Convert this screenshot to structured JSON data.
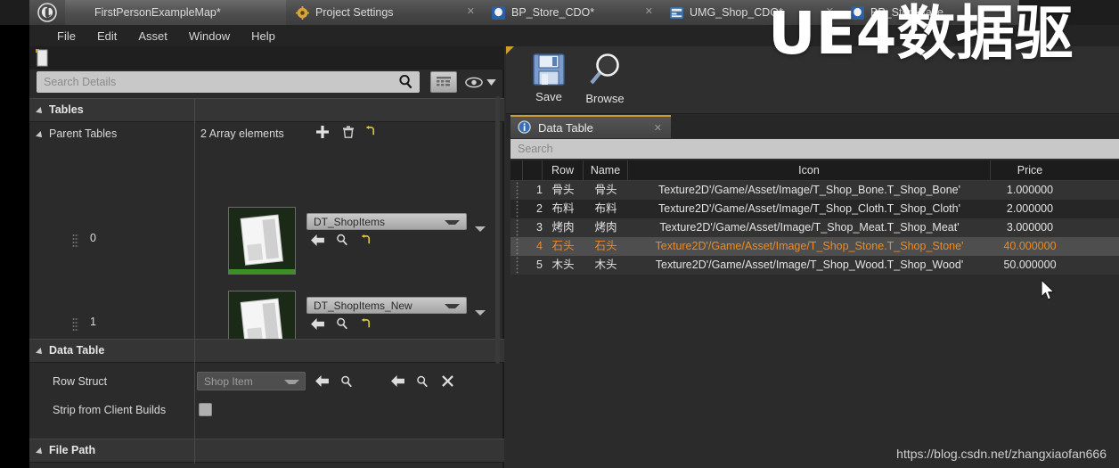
{
  "app": {
    "logo_icon": "unreal-engine-logo",
    "overlay_text": "UE4数据驱",
    "watermark": "https://blog.csdn.net/zhangxiaofan666"
  },
  "tabs": [
    {
      "label": "FirstPersonExampleMap*",
      "icon": "unreal-logo-icon",
      "active": true,
      "closable": false
    },
    {
      "label": "Project Settings",
      "icon": "gear-icon",
      "active": false,
      "closable": true
    },
    {
      "label": "BP_Store_CDO*",
      "icon": "blueprint-icon",
      "active": false,
      "closable": true
    },
    {
      "label": "UMG_Shop_CDO*",
      "icon": "widget-icon",
      "active": false,
      "closable": true
    },
    {
      "label": "BP_StoreBase",
      "icon": "blueprint-icon",
      "active": false,
      "closable": true
    }
  ],
  "menubar": {
    "items": [
      "File",
      "Edit",
      "Asset",
      "Window",
      "Help"
    ]
  },
  "details_panel": {
    "search": {
      "placeholder": "Search Details",
      "value": ""
    },
    "grid_button_icon": "grid-view-icon",
    "eye_button_icon": "eye-icon",
    "caret_icon": "chevron-down-icon",
    "categories": [
      {
        "label": "Tables"
      },
      {
        "label": "Data Table"
      },
      {
        "label": "File Path"
      }
    ],
    "parent_tables": {
      "label": "Parent Tables",
      "array_count": "2 Array elements",
      "add_icon": "plus-icon",
      "delete_icon": "trash-icon",
      "reset_icon": "revert-arrow-icon",
      "elements": [
        {
          "index": "0",
          "asset": "DT_ShopItems",
          "thumb_icon": "datatable-asset-thumbnail"
        },
        {
          "index": "1",
          "asset": "DT_ShopItems_New",
          "thumb_icon": "datatable-asset-thumbnail"
        }
      ],
      "element_actions": [
        "use-selected-arrow-icon",
        "browse-magnifier-icon",
        "reset-arrow-icon"
      ]
    },
    "data_table_section": {
      "row_struct": {
        "label": "Row Struct",
        "value": "Shop Item"
      },
      "row_struct_actions": [
        "use-selected-arrow-icon",
        "browse-magnifier-icon",
        "use-selected-arrow-icon",
        "browse-magnifier-icon",
        "clear-x-icon"
      ],
      "strip_from_client_builds": {
        "label": "Strip from Client Builds",
        "checked": false
      }
    }
  },
  "asset_editor": {
    "toolbar": [
      {
        "label": "Save",
        "icon": "save-floppy-icon"
      },
      {
        "label": "Browse",
        "icon": "browse-magnifier-icon"
      }
    ],
    "tab": {
      "label": "Data Table",
      "icon": "info-magnifier-icon",
      "close_icon": "close-x-icon"
    },
    "search": {
      "placeholder": "Search",
      "value": ""
    },
    "table": {
      "columns": [
        "",
        "Row",
        "Name",
        "Icon",
        "Price"
      ],
      "selected_row_index": 4,
      "selection_color": "#f08a1e",
      "rows": [
        {
          "num": "1",
          "row": "骨头",
          "name": "骨头",
          "icon": "Texture2D'/Game/Asset/Image/T_Shop_Bone.T_Shop_Bone'",
          "price": "1.000000"
        },
        {
          "num": "2",
          "row": "布料",
          "name": "布料",
          "icon": "Texture2D'/Game/Asset/Image/T_Shop_Cloth.T_Shop_Cloth'",
          "price": "2.000000"
        },
        {
          "num": "3",
          "row": "烤肉",
          "name": "烤肉",
          "icon": "Texture2D'/Game/Asset/Image/T_Shop_Meat.T_Shop_Meat'",
          "price": "3.000000"
        },
        {
          "num": "4",
          "row": "石头",
          "name": "石头",
          "icon": "Texture2D'/Game/Asset/Image/T_Shop_Stone.T_Shop_Stone'",
          "price": "40.000000"
        },
        {
          "num": "5",
          "row": "木头",
          "name": "木头",
          "icon": "Texture2D'/Game/Asset/Image/T_Shop_Wood.T_Shop_Wood'",
          "price": "50.000000"
        }
      ]
    }
  },
  "colors": {
    "panel_bg": "#2b2b2b",
    "titlebar_bg": "#1d1d1d",
    "accent_yellow": "#c8a02a",
    "selection_orange": "#f08a1e",
    "asset_green": "#3f8f26"
  }
}
